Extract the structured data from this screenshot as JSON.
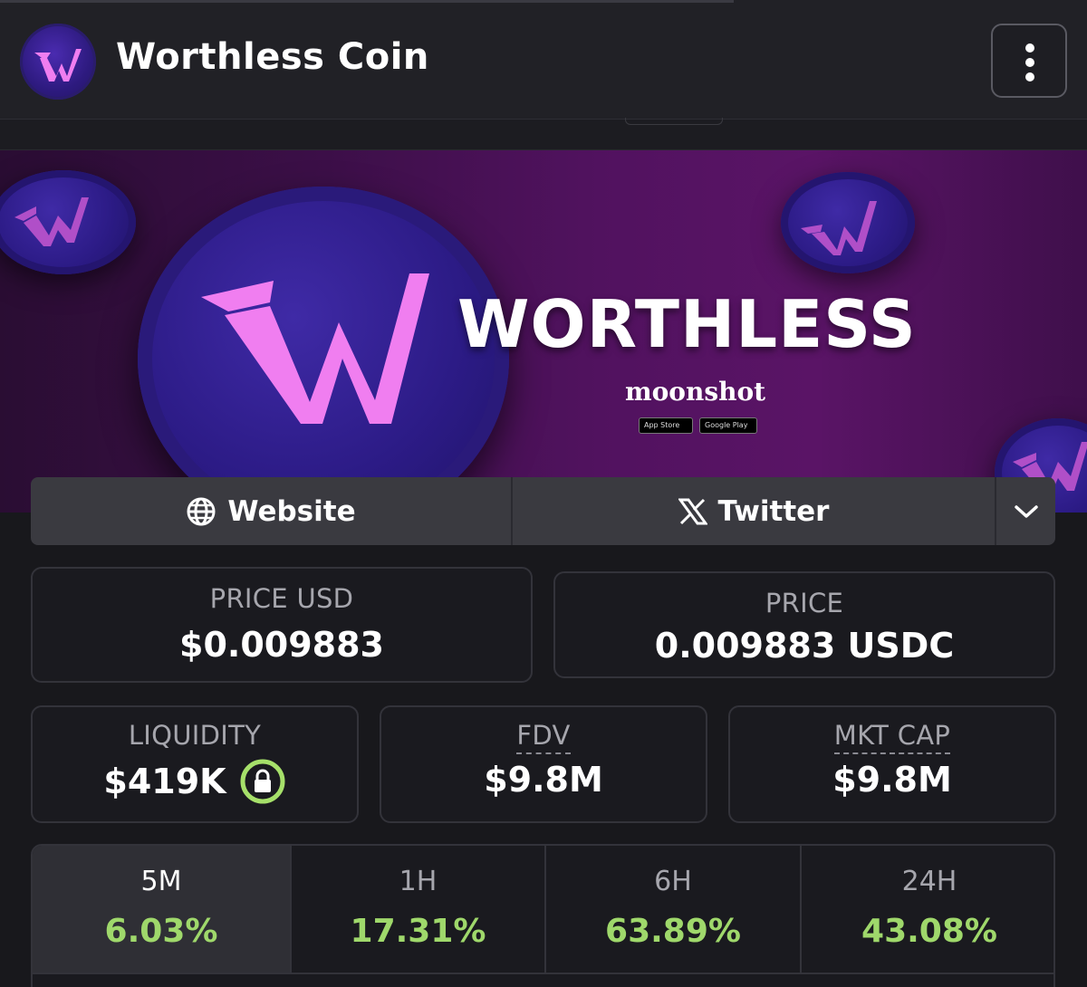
{
  "header": {
    "title": "Worthless Coin",
    "logo_icon": "worthless-w-logo",
    "menu_icon": "more-vertical-icon"
  },
  "banner": {
    "brand": "WORTHLESS",
    "sub": "moonshot",
    "app_store": "App Store",
    "google_play": "Google Play"
  },
  "social": {
    "website_label": "Website",
    "website_icon": "globe-icon",
    "twitter_label": "Twitter",
    "twitter_icon": "x-logo-icon",
    "more_icon": "chevron-down-icon"
  },
  "price": {
    "usd_label": "PRICE USD",
    "usd_value": "$0.009883",
    "native_label": "PRICE",
    "native_value": "0.009883 USDC"
  },
  "stats": {
    "liquidity_label": "LIQUIDITY",
    "liquidity_value": "$419K",
    "fdv_label": "FDV",
    "fdv_value": "$9.8M",
    "mktcap_label": "MKT CAP",
    "mktcap_value": "$9.8M"
  },
  "timeframes": [
    {
      "label": "5M",
      "change": "6.03%",
      "active": true
    },
    {
      "label": "1H",
      "change": "17.31%",
      "active": false
    },
    {
      "label": "6H",
      "change": "63.89%",
      "active": false
    },
    {
      "label": "24H",
      "change": "43.08%",
      "active": false
    }
  ],
  "colors": {
    "positive": "#9fd86b",
    "lock_ring": "#a6e06a",
    "brand_pink": "#f07ef0",
    "coin_blue": "#2c1b86"
  }
}
